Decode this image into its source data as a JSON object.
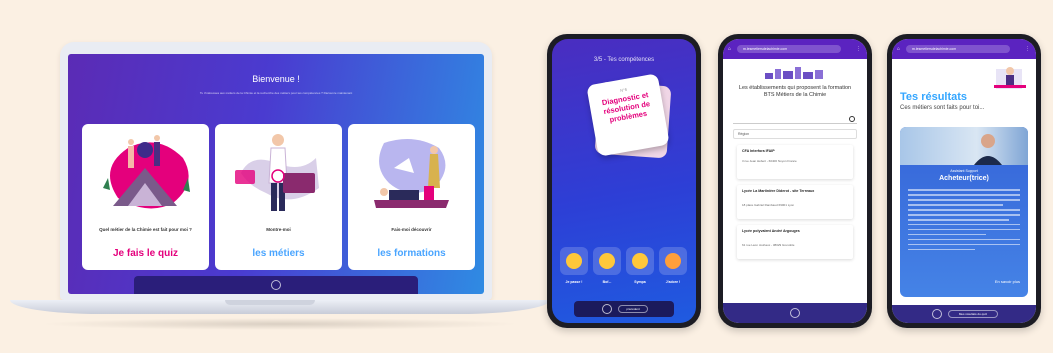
{
  "laptop": {
    "welcome": "Bienvenue !",
    "subtitle": "Tu t'intéresses aux métiers de la Chimie et la recherche des métiers pour tes compétences ? Découvre maintenant",
    "cards": [
      {
        "caption": "Quel métier de la Chimie est fait pour moi ?",
        "cta": "Je fais le quiz"
      },
      {
        "caption": "Montre-moi",
        "cta": "les métiers"
      },
      {
        "caption": "Fais-moi découvrir",
        "cta": "les formations"
      }
    ]
  },
  "phone1": {
    "title": "3/5 - Tes compétences",
    "card_number": "N°6",
    "card_text": "Diagnostic et résolution de problèmes",
    "options": [
      "Je passe !",
      "Bof...",
      "Sympa",
      "J'adore !"
    ],
    "bottom_button": "précédent",
    "emoji_colors": [
      "#ffc83a",
      "#ffc83a",
      "#ffc83a",
      "#ff9f3a"
    ]
  },
  "phone2": {
    "url": "m.lesmetiersdelachimie.com",
    "heading": "Les établissements qui proposent la formation BTS Métiers de la Chimie",
    "region_label": "Région",
    "establishments": [
      {
        "name": "CFA Interfora IFAIP",
        "address": "3 rue Jean Hébert - 60400 Noyon France"
      },
      {
        "name": "Lycée La Martinière Diderot - site Terreaux",
        "address": "18 place Gabriel Rambaud 69001 Lyon"
      },
      {
        "name": "Lycée polyvalent André Argouges",
        "address": "61 rue Léon Jouhaux - 38029 Grenoble"
      }
    ]
  },
  "phone3": {
    "url": "m.lesmetiersdelachimie.com",
    "results_title": "Tes résultats",
    "results_sub": "Ces métiers sont faits pour toi...",
    "job_tag": "Assistant Support",
    "job_title": "Acheteur(trice)",
    "more_link": "En savoir plus",
    "bottom_button": "Mes résultats du quiz"
  },
  "colors": {
    "accent_pink": "#e4007c",
    "accent_blue": "#34a6ff",
    "brand_purple": "#5b23c0"
  }
}
